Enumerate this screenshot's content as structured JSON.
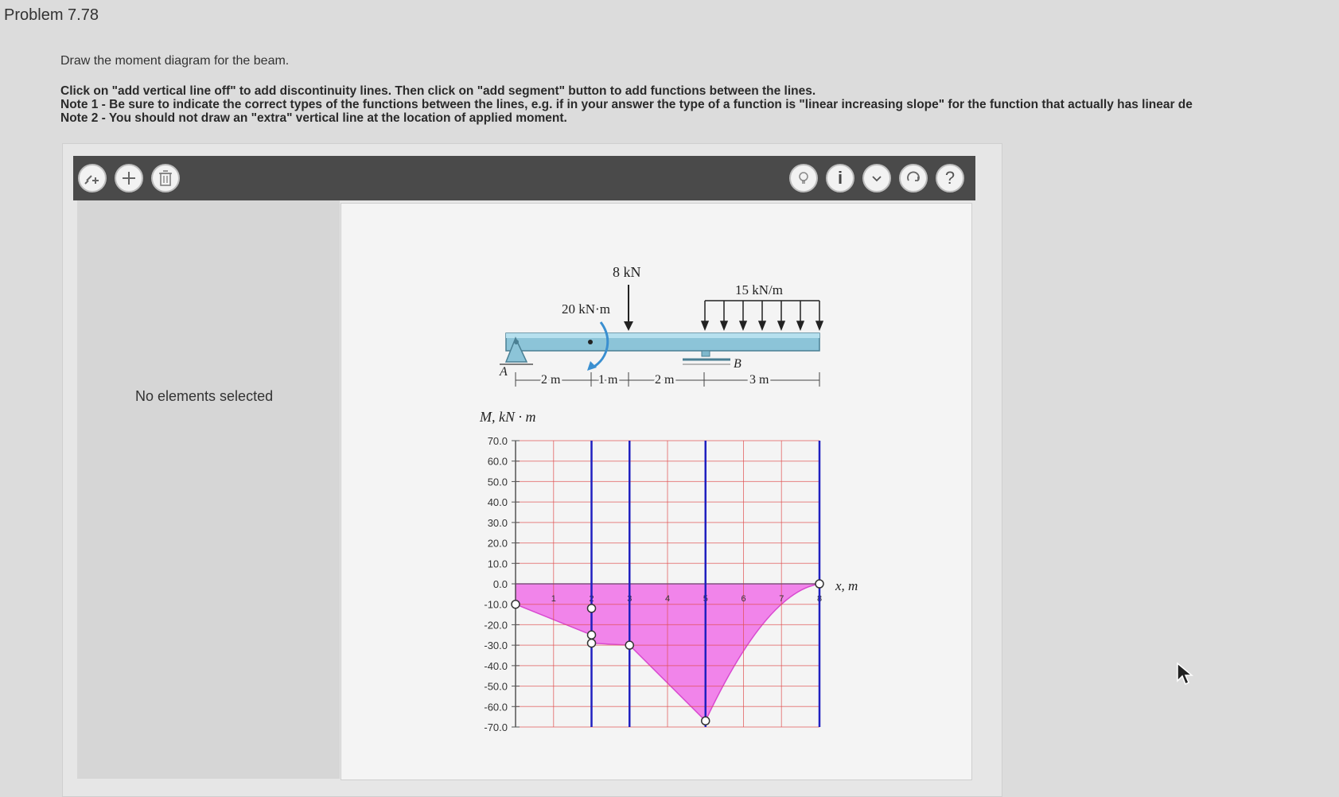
{
  "header": {
    "title": "Problem 7.78"
  },
  "instructions": {
    "intro": "Draw the moment diagram for the beam.",
    "lines": [
      "Click on \"add vertical line off\" to add discontinuity lines. Then click on \"add segment\" button to add functions between the lines.",
      "Note 1 - Be sure to indicate the correct types of the functions between the lines, e.g. if in your answer the type of a function is \"linear increasing slope\" for the function that actually has linear de",
      "Note 2 - You should not draw an \"extra\" vertical line at the location of applied moment."
    ]
  },
  "toolbar": {
    "left_icons": [
      "add-vertical-line-icon",
      "add-segment-icon",
      "trash-icon"
    ],
    "right_icons": [
      "hint-icon",
      "info-icon",
      "check-icon",
      "reset-icon",
      "help-icon"
    ],
    "info_glyph": "i",
    "help_glyph": "?"
  },
  "left_panel": {
    "status": "No elements selected"
  },
  "beam_figure": {
    "point_load": "8 kN",
    "distributed_load": "15 kN/m",
    "applied_moment": "20 kN·m",
    "support_a": "A",
    "support_b": "B",
    "dims": [
      "2 m",
      "1 m",
      "2 m",
      "3 m"
    ]
  },
  "chart_data": {
    "type": "line",
    "ylabel": "M, kN · m",
    "xlabel": "x, m",
    "ylim": [
      -70,
      70
    ],
    "xlim": [
      0,
      8
    ],
    "y_ticks": [
      "70.0",
      "60.0",
      "50.0",
      "40.0",
      "30.0",
      "20.0",
      "10.0",
      "0.0",
      "-10.0",
      "-20.0",
      "-30.0",
      "-40.0",
      "-50.0",
      "-60.0",
      "-70.0"
    ],
    "x_ticks": [
      "1",
      "2",
      "3",
      "4",
      "5",
      "6",
      "7",
      "8"
    ],
    "discontinuity_lines_x": [
      2,
      3,
      5,
      8
    ],
    "series": [
      {
        "points": [
          [
            0,
            -10
          ],
          [
            2,
            -25
          ],
          [
            2,
            -12
          ],
          [
            2,
            -29
          ],
          [
            3,
            -30
          ],
          [
            5,
            -67
          ],
          [
            8,
            0
          ]
        ]
      }
    ],
    "fill_color": "#f070e8",
    "line_color": "#d84ad0",
    "grid_color": "#e05050",
    "vline_color": "#2020c0"
  }
}
